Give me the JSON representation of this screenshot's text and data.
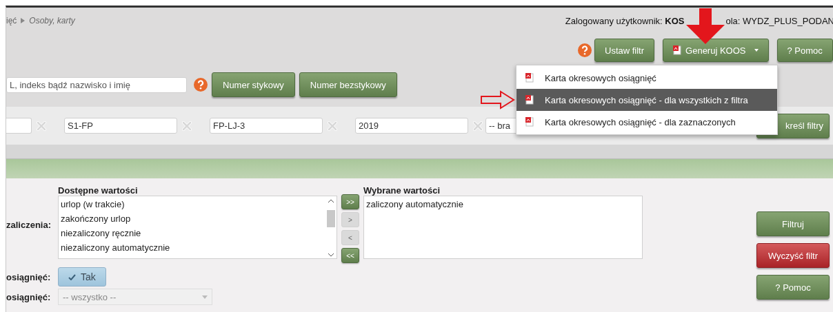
{
  "breadcrumb": [
    {
      "text": "ięć"
    },
    {
      "text": "Osoby, karty"
    }
  ],
  "user_info": {
    "label": "Zalogowany użytkownik: **KOS**",
    "role": "ola: WYDZ_PLUS_PODAN"
  },
  "toolbar": {
    "buttons": [
      {
        "label": "Ustaw filtr",
        "kind": "plain"
      },
      {
        "label": "Generuj KOOS",
        "kind": "dropdown"
      },
      {
        "label": "? Pomoc",
        "kind": "plain"
      }
    ]
  },
  "generate_menu": {
    "items": [
      {
        "label": "Karta okresowych osiągnięć",
        "selected": false
      },
      {
        "label": "Karta okresowych osiągnięć - dla wszystkich z filtra",
        "selected": true
      },
      {
        "label": "Karta okresowych osiągnięć - dla zaznaczonych",
        "selected": false
      }
    ]
  },
  "search": {
    "placeholder": "L, indeks bądź nazwisko i imię",
    "buttons": [
      "Numer stykowy",
      "Numer bezstykowy"
    ]
  },
  "filters": {
    "fields": [
      {
        "kind": "empty"
      },
      {
        "kind": "text",
        "value": "S1-FP"
      },
      {
        "kind": "text",
        "value": "FP-LJ-3"
      },
      {
        "kind": "text",
        "value": "2019"
      }
    ],
    "select": {
      "value": "-- bra"
    },
    "apply_button": "kreśl filtry"
  },
  "multiselect": {
    "label": "zaliczenia:",
    "available": {
      "title": "Dostępne wartości",
      "items": [
        "urlop (w trakcie)",
        "zakończony urlop",
        "niezaliczony ręcznie",
        "niezaliczony automatycznie"
      ]
    },
    "chosen": {
      "title": "Wybrane wartości",
      "items": [
        "zaliczony automatycznie"
      ]
    },
    "move_buttons": [
      {
        "label": ">>",
        "disabled": false
      },
      {
        "label": ">",
        "disabled": true
      },
      {
        "label": "<",
        "disabled": true
      },
      {
        "label": "<<",
        "disabled": false
      }
    ]
  },
  "toggle": {
    "label": "osiągnięć:",
    "text": "Tak",
    "checked": true
  },
  "select_row": {
    "label": "osiągnięć:",
    "value": "-- wszystko --",
    "disabled": true
  },
  "side_buttons": [
    {
      "label": "Filtruj",
      "kind": "primary"
    },
    {
      "label": "Wyczyść filtr",
      "kind": "danger"
    },
    {
      "label": "? Pomoc",
      "kind": "primary"
    }
  ]
}
